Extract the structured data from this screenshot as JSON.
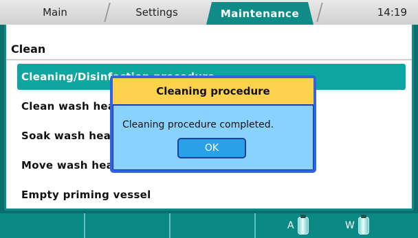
{
  "header": {
    "tabs": [
      {
        "label": "Main"
      },
      {
        "label": "Settings"
      },
      {
        "label": "Maintenance",
        "active": true
      }
    ],
    "clock": "14:19"
  },
  "section": {
    "title": "Clean",
    "items": [
      {
        "label": "Cleaning/Disinfection procedure",
        "selected": true
      },
      {
        "label": "Clean wash heads"
      },
      {
        "label": "Soak wash heads"
      },
      {
        "label": "Move wash heads"
      },
      {
        "label": "Empty priming vessel"
      }
    ]
  },
  "bottombar": {
    "bottles": [
      {
        "label": "A"
      },
      {
        "label": "W"
      }
    ]
  },
  "dialog": {
    "title": "Cleaning procedure",
    "message": "Cleaning procedure completed.",
    "ok_label": "OK"
  },
  "colors": {
    "accent": "#0fa6a1",
    "dialog_header": "#ffd24d",
    "dialog_body": "#89d2ff"
  }
}
